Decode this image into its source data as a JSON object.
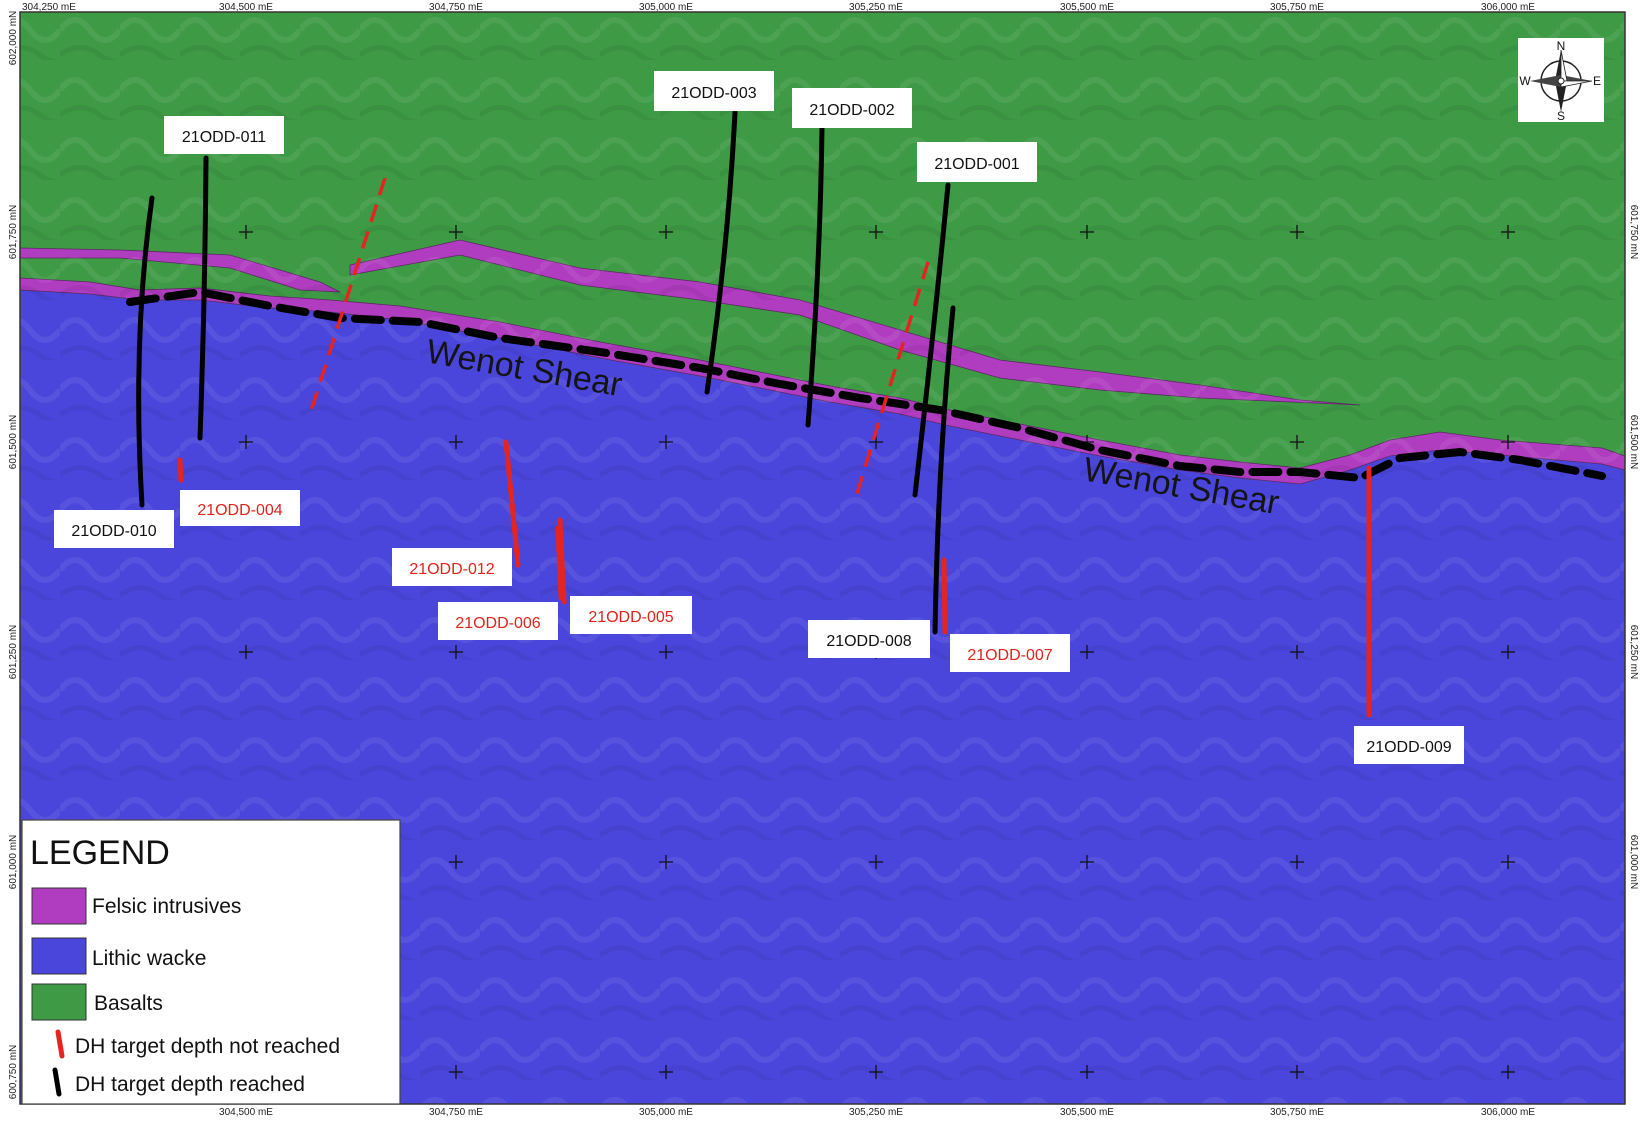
{
  "colors": {
    "basalts": "#3e9a45",
    "lithic_wacke": "#4a46dc",
    "felsic": "#b03cc0",
    "not_reached": "#e52420",
    "reached": "#000000",
    "label_red": "#e0231b"
  },
  "grid": {
    "easting_top": [
      "304,250 mE",
      "304,500 mE",
      "304,750 mE",
      "305,000 mE",
      "305,250 mE",
      "305,500 mE",
      "305,750 mE",
      "306,000 mE"
    ],
    "easting_bottom": [
      "304,500 mE",
      "304,750 mE",
      "305,000 mE",
      "305,250 mE",
      "305,500 mE",
      "305,750 mE",
      "306,000 mE"
    ],
    "northing_left": [
      "602,000 mN",
      "601,750 mN",
      "601,500 mN",
      "601,250 mN",
      "601,000 mN",
      "600,750 mN"
    ],
    "northing_right": [
      "601,750 mN",
      "601,500 mN",
      "601,250 mN",
      "601,000 mN"
    ]
  },
  "structure_labels": [
    "Wenot Shear",
    "Wenot Shear"
  ],
  "north_arrow": {
    "n": "N",
    "s": "S",
    "e": "E",
    "w": "W"
  },
  "drillholes": [
    {
      "id": "21ODD-001",
      "status": "reached"
    },
    {
      "id": "21ODD-002",
      "status": "reached"
    },
    {
      "id": "21ODD-003",
      "status": "reached"
    },
    {
      "id": "21ODD-004",
      "status": "not_reached"
    },
    {
      "id": "21ODD-005",
      "status": "not_reached"
    },
    {
      "id": "21ODD-006",
      "status": "not_reached"
    },
    {
      "id": "21ODD-007",
      "status": "not_reached"
    },
    {
      "id": "21ODD-008",
      "status": "reached"
    },
    {
      "id": "21ODD-009",
      "status": "not_reached"
    },
    {
      "id": "21ODD-010",
      "status": "reached"
    },
    {
      "id": "21ODD-011",
      "status": "reached"
    },
    {
      "id": "21ODD-012",
      "status": "not_reached"
    }
  ],
  "legend": {
    "title": "LEGEND",
    "items": [
      {
        "label": "Felsic intrusives"
      },
      {
        "label": "Lithic wacke"
      },
      {
        "label": "Basalts"
      },
      {
        "label": "DH target depth not reached"
      },
      {
        "label": "DH target depth reached"
      }
    ]
  }
}
